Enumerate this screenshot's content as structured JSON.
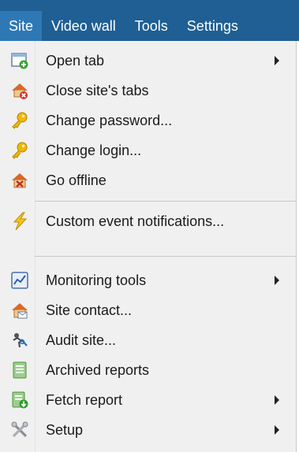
{
  "menubar": {
    "items": [
      {
        "label": "Site",
        "active": true
      },
      {
        "label": "Video wall"
      },
      {
        "label": "Tools"
      },
      {
        "label": "Settings"
      }
    ]
  },
  "menu": {
    "items": [
      {
        "label": "Open tab",
        "icon": "open-tab-icon",
        "submenu": true
      },
      {
        "label": "Close site's tabs",
        "icon": "close-tabs-icon"
      },
      {
        "label": "Change password...",
        "icon": "key-icon"
      },
      {
        "label": "Change login...",
        "icon": "key-icon"
      },
      {
        "label": "Go offline",
        "icon": "offline-house-icon"
      },
      {
        "label": "Custom event notifications...",
        "icon": "lightning-icon"
      },
      {
        "label": "Monitoring tools",
        "icon": "monitor-chart-icon",
        "submenu": true
      },
      {
        "label": "Site contact...",
        "icon": "site-contact-icon"
      },
      {
        "label": "Audit site...",
        "icon": "audit-icon"
      },
      {
        "label": "Archived reports",
        "icon": "report-icon"
      },
      {
        "label": "Fetch report",
        "icon": "fetch-report-icon",
        "submenu": true
      },
      {
        "label": "Setup",
        "icon": "setup-tools-icon",
        "submenu": true
      }
    ]
  },
  "colors": {
    "menubar_bg": "#1f5f94",
    "active_tab_bg": "#2e78b5",
    "menu_bg": "#f0f0f0"
  }
}
